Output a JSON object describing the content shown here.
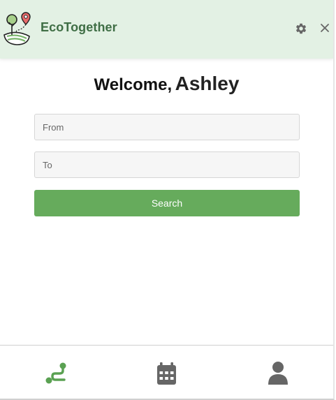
{
  "header": {
    "app_title": "EcoTogether",
    "logo_icon": "eco-logo-icon",
    "settings_icon": "gear-icon",
    "close_icon": "close-icon",
    "background": "#e3f1e4",
    "title_color": "#3f6e45"
  },
  "welcome": {
    "greeting": "Welcome,",
    "name": "Ashley"
  },
  "search_form": {
    "from_placeholder": "From",
    "from_value": "",
    "to_placeholder": "To",
    "to_value": "",
    "search_label": "Search",
    "button_color": "#66ab5c"
  },
  "bottom_nav": {
    "items": [
      {
        "icon": "route-icon",
        "active": true,
        "color": "#5aa152"
      },
      {
        "icon": "calendar-icon",
        "active": false,
        "color": "#666666"
      },
      {
        "icon": "user-icon",
        "active": false,
        "color": "#666666"
      }
    ]
  }
}
